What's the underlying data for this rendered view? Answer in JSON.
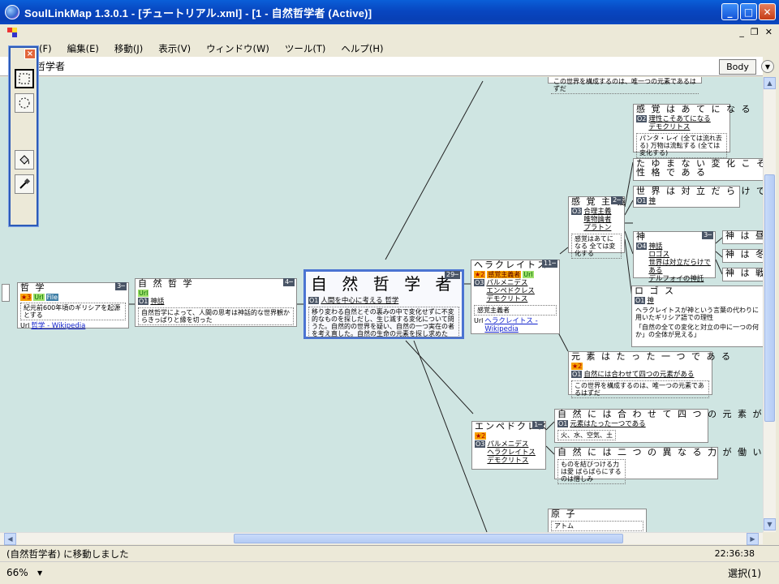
{
  "window": {
    "title": "SoulLinkMap 1.3.0.1 - [チュートリアル.xml] - [1 - 自然哲学者 (Active)]"
  },
  "menu": {
    "items": [
      "(F)",
      "編集(E)",
      "移動(J)",
      "表示(V)",
      "ウィンドウ(W)",
      "ツール(T)",
      "ヘルプ(H)"
    ]
  },
  "nodebar": {
    "name": "哲学者",
    "mode_button": "Body"
  },
  "palette": {
    "close": "×"
  },
  "nodes": {
    "tetsugaku": {
      "title": "哲 学",
      "tags": [
        "★3",
        "Url",
        "File"
      ],
      "text": "紀元前600年頃のギリシアを起源とする",
      "badge": "3─",
      "url_label": "Url",
      "url": "哲学 - Wikipedia"
    },
    "shizen": {
      "title": "自 然 哲 学",
      "tag": "Url",
      "o_tag": "O1",
      "item": "神話",
      "text": "自然哲学によって、人間の思考は神話的な世界観からきっぱりと縁を切った",
      "badge": "4─"
    },
    "main": {
      "title": "自 然 哲 学 者",
      "o_tag": "O1",
      "item": "人間を中心に考える 哲学",
      "text": "移り変わる自然とその裏みの中で変化せずに不変的なものを探しだし、生じ滅する変化について問うた。自然的の世界を疑い、自然の一つ実在の者を考え直した。自然の生命の元素を探し求めた",
      "badge": "29─"
    },
    "heraclitus": {
      "title": "ヘラクレイトス",
      "badge": "11─",
      "star": "★2",
      "tag1": "感覚主義者",
      "tag2": "Url",
      "o_tag": "O3",
      "items": [
        "パルメニデス",
        "エンペドクレス",
        "デモクリトス"
      ],
      "text": "感覚主義者",
      "url_label": "Url",
      "url": "ヘラクレイトス - Wikipedia"
    },
    "empedocles": {
      "title": "エンペドクレス",
      "badge": "1─",
      "star": "★2",
      "o_tag": "O3",
      "items": [
        "パルメニデス",
        "ヘラクレイトス",
        "デモクリトス"
      ]
    },
    "kankaku_shugi": {
      "title": "感 覚 主 義",
      "badge": "2─",
      "o_tag": "O3",
      "items": [
        "合理主義",
        "唯物論者",
        "プラトン"
      ],
      "text": "感覚はあてになる 全ては変化する"
    },
    "kankaku_ate": {
      "title": "感 覚 は あ て に な る",
      "o_tag": "O2",
      "items": [
        "理性こそあてになる",
        "デモクリトス"
      ],
      "text": "パンタ・レイ (全ては流れ去る) 万物は流転する (全ては変化する)"
    },
    "taemanai": {
      "title": "た ゆ ま な い 変 化 こ そ が 自 然 の も",
      "sub": "性 格 で あ る"
    },
    "sekai_tairitsu": {
      "title": "世 界 は 対 立 だ ら け で あ る",
      "o_tag": "O1",
      "item": "神"
    },
    "kami": {
      "title": "神",
      "badge": "3─",
      "o_tag": "O4",
      "items": [
        "神話",
        "ロゴス",
        "世界は対立だらけである",
        "デルフォイの神託"
      ]
    },
    "kami_hiru": {
      "title": "神 は 昼"
    },
    "kami_fuyu": {
      "title": "神 は 冬"
    },
    "kami_sen": {
      "title": "神 は 戦"
    },
    "logos": {
      "title": "ロ ゴ ス",
      "o_tag": "O1",
      "item": "神",
      "text1": "ヘラクレイトスが神という言葉の代わりに用いたギリシア語での理性",
      "text2": "「自然の全ての変化と対立の中に一つの何か」の全体が見える」"
    },
    "genso_one": {
      "title": "元 素 は た っ た 一 つ で あ る",
      "star": "★2",
      "o_tag": "O1",
      "item": "自然には合わせて四つの元素がある",
      "text": "この世界を構成するのは、唯一つの元素であるはずだ"
    },
    "shizen_yottsu": {
      "title": "自 然 に は 合 わ せ て 四 つ の 元 素 が あ る",
      "o_tag": "O1",
      "item": "元素はたった一つである",
      "text": "火、水、空気、土"
    },
    "shizen_futatsu": {
      "title": "自 然 に は 二 つ の 異 な る 力 が 働 い て い る",
      "text": "ものを結びつける力は愛 ばらばらにするのは憎しみ"
    },
    "genshi": {
      "title": "原 子",
      "text": "アトム"
    },
    "top_partial": {
      "text": "この世界を構成するのは、唯一つの元素であるはずだ"
    }
  },
  "status": {
    "message": "(自然哲学者) に移動しました",
    "time": "22:36:38"
  },
  "bottom": {
    "zoom": "66%",
    "selection": "選択(1)"
  }
}
